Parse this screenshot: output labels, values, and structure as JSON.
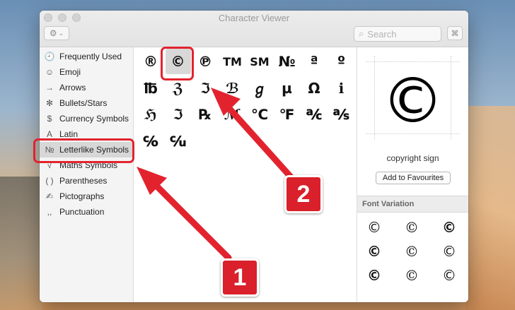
{
  "window": {
    "title": "Character Viewer"
  },
  "toolbar": {
    "gear_icon": "gear-icon",
    "search_placeholder": "Search",
    "grid_icon": "grid-icon"
  },
  "sidebar": {
    "items": [
      {
        "icon": "clock-icon",
        "glyph": "🕘",
        "label": "Frequently Used"
      },
      {
        "icon": "smiley-icon",
        "glyph": "☺",
        "label": "Emoji"
      },
      {
        "icon": "arrow-icon",
        "glyph": "→",
        "label": "Arrows"
      },
      {
        "icon": "asterisk-icon",
        "glyph": "✻",
        "label": "Bullets/Stars"
      },
      {
        "icon": "dollar-icon",
        "glyph": "$",
        "label": "Currency Symbols"
      },
      {
        "icon": "latin-a-icon",
        "glyph": "A",
        "label": "Latin"
      },
      {
        "icon": "numero-icon",
        "glyph": "№",
        "label": "Letterlike Symbols"
      },
      {
        "icon": "sqrt-icon",
        "glyph": "√",
        "label": "Maths Symbols"
      },
      {
        "icon": "parentheses-icon",
        "glyph": "( )",
        "label": "Parentheses"
      },
      {
        "icon": "pictograph-icon",
        "glyph": "✍",
        "label": "Pictographs"
      },
      {
        "icon": "punctuation-icon",
        "glyph": ",,",
        "label": "Punctuation"
      }
    ],
    "selected": "Letterlike Symbols"
  },
  "characters": [
    "®",
    "©",
    "℗",
    "TM",
    "SM",
    "№",
    "ª",
    "º",
    "℔",
    "ℨ",
    "ℑ",
    "ℬ",
    "ℊ",
    "µ",
    "Ω",
    "ℹ",
    "ℌ",
    "ℑ",
    "℞",
    "ℳ",
    "℃",
    "℉",
    "℀",
    "℁",
    "℅",
    "℆"
  ],
  "selected_character": "©",
  "detail": {
    "glyph": "©",
    "name": "copyright sign",
    "favourites_button": "Add to Favourites",
    "font_variation_header": "Font Variation",
    "variations": [
      "©",
      "©",
      "©",
      "©",
      "©",
      "©",
      "©",
      "©",
      "©"
    ]
  },
  "annotations": {
    "badge1": "1",
    "badge2": "2",
    "color": "#e2232e"
  }
}
